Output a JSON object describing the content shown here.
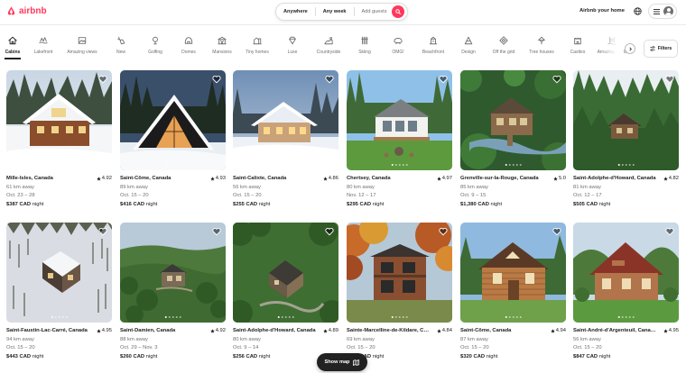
{
  "header": {
    "logo_text": "airbnb",
    "search": {
      "anywhere": "Anywhere",
      "any_week": "Any week",
      "add_guests": "Add guests"
    },
    "host_link": "Airbnb your home"
  },
  "categories": [
    {
      "label": "Cabins",
      "icon": "cabin-icon",
      "active": true
    },
    {
      "label": "Lakefront",
      "icon": "lakefront-icon"
    },
    {
      "label": "Amazing views",
      "icon": "amazing-views-icon"
    },
    {
      "label": "New",
      "icon": "new-icon"
    },
    {
      "label": "Golfing",
      "icon": "golfing-icon"
    },
    {
      "label": "Domes",
      "icon": "domes-icon"
    },
    {
      "label": "Mansions",
      "icon": "mansions-icon"
    },
    {
      "label": "Tiny homes",
      "icon": "tiny-homes-icon"
    },
    {
      "label": "Luxe",
      "icon": "luxe-icon"
    },
    {
      "label": "Countryside",
      "icon": "countryside-icon"
    },
    {
      "label": "Skiing",
      "icon": "skiing-icon"
    },
    {
      "label": "OMG!",
      "icon": "omg-icon"
    },
    {
      "label": "Beachfront",
      "icon": "beachfront-icon"
    },
    {
      "label": "Design",
      "icon": "design-icon"
    },
    {
      "label": "Off the grid",
      "icon": "off-the-grid-icon"
    },
    {
      "label": "Tree houses",
      "icon": "tree-houses-icon"
    },
    {
      "label": "Castles",
      "icon": "castles-icon"
    },
    {
      "label": "Amazing pools",
      "icon": "amazing-pools-icon"
    }
  ],
  "filters_label": "Filters",
  "price_suffix": "night",
  "listings": [
    {
      "title": "Mille-Isles, Canada",
      "rating": "4.92",
      "distance": "61 km away",
      "dates": "Oct. 23 – 28",
      "price": "$387 CAD",
      "scene": "snow"
    },
    {
      "title": "Saint-Côme, Canada",
      "rating": "4.93",
      "distance": "89 km away",
      "dates": "Oct. 15 – 20",
      "price": "$416 CAD",
      "scene": "aframe"
    },
    {
      "title": "Saint-Calixte, Canada",
      "rating": "4.86",
      "distance": "56 km away",
      "dates": "Oct. 15 – 20",
      "price": "$255 CAD",
      "scene": "snowdusk"
    },
    {
      "title": "Chertsey, Canada",
      "rating": "4.97",
      "distance": "80 km away",
      "dates": "Nov. 12 – 17",
      "price": "$295 CAD",
      "scene": "lawn"
    },
    {
      "title": "Grenville-sur-la-Rouge, Canada",
      "rating": "5.0",
      "distance": "85 km away",
      "dates": "Oct. 9 – 15",
      "price": "$1,380 CAD",
      "scene": "forest"
    },
    {
      "title": "Saint-Adolphe-d'Howard, Canada",
      "rating": "4.82",
      "distance": "81 km away",
      "dates": "Oct. 12 – 17",
      "price": "$505 CAD",
      "scene": "forest2"
    },
    {
      "title": "Saint-Faustin-Lac-Carré, Canada",
      "rating": "4.95",
      "distance": "94 km away",
      "dates": "Oct. 15 – 20",
      "price": "$443 CAD",
      "scene": "aerialsnow"
    },
    {
      "title": "Saint-Damien, Canada",
      "rating": "4.92",
      "distance": "88 km away",
      "dates": "Oct. 29 – Nov. 3",
      "price": "$260 CAD",
      "scene": "aerial"
    },
    {
      "title": "Saint-Adolphe-d'Howard, Canada",
      "rating": "4.89",
      "distance": "80 km away",
      "dates": "Oct. 9 – 14",
      "price": "$256 CAD",
      "scene": "aerial2"
    },
    {
      "title": "Sainte-Marcelline-de-Kildare, Canada",
      "rating": "4.84",
      "distance": "69 km away",
      "dates": "Oct. 15 – 20",
      "price": "$295 CAD",
      "scene": "autumn"
    },
    {
      "title": "Saint-Côme, Canada",
      "rating": "4.94",
      "distance": "87 km away",
      "dates": "Oct. 15 – 20",
      "price": "$320 CAD",
      "scene": "log"
    },
    {
      "title": "Saint-André-d'Argenteuil, Canada",
      "rating": "4.95",
      "distance": "56 km away",
      "dates": "Oct. 15 – 20",
      "price": "$847 CAD",
      "scene": "redroof"
    }
  ],
  "show_map": "Show map"
}
